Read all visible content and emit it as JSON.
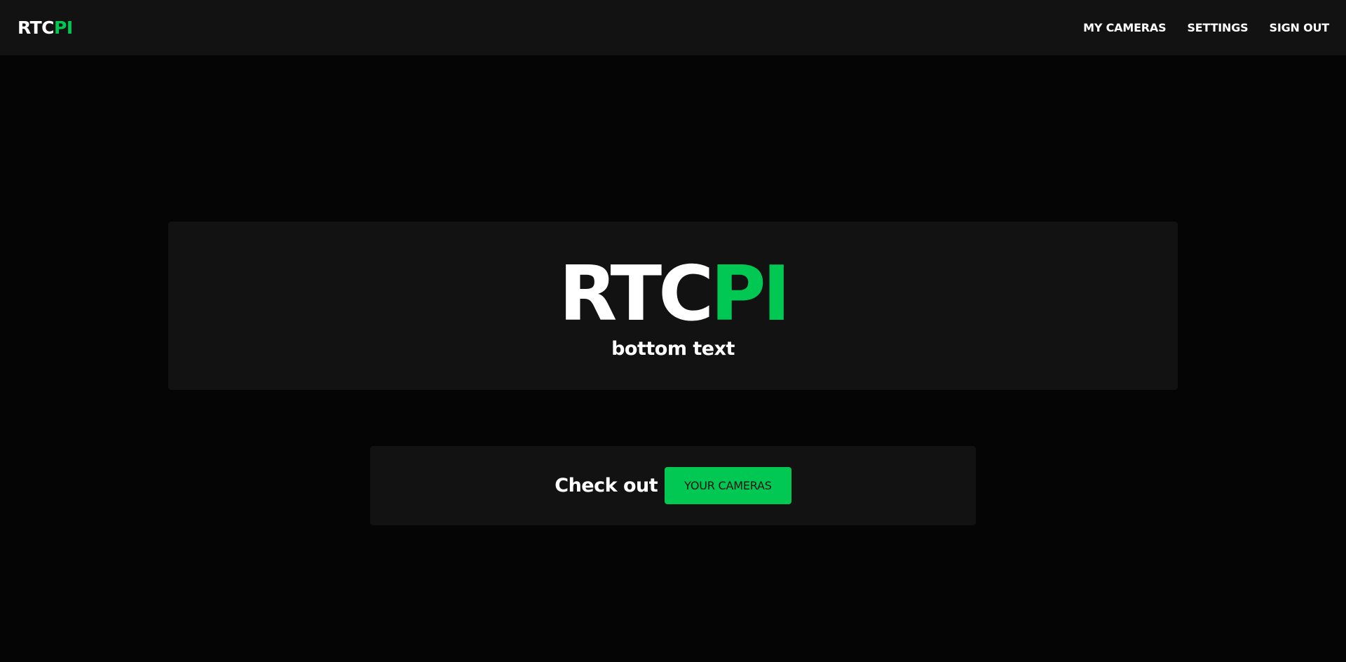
{
  "colors": {
    "accent": "#00c853",
    "background": "#050505",
    "surface": "#121212",
    "text": "#ffffff"
  },
  "navbar": {
    "brand": {
      "primary": "RTC",
      "accent": "PI"
    },
    "links": [
      {
        "label": "MY CAMERAS"
      },
      {
        "label": "SETTINGS"
      },
      {
        "label": "SIGN OUT"
      }
    ]
  },
  "hero": {
    "title": {
      "primary": "RTC",
      "accent": "PI"
    },
    "subtitle": "bottom text"
  },
  "cta": {
    "text": "Check out",
    "button_label": "YOUR CAMERAS"
  }
}
